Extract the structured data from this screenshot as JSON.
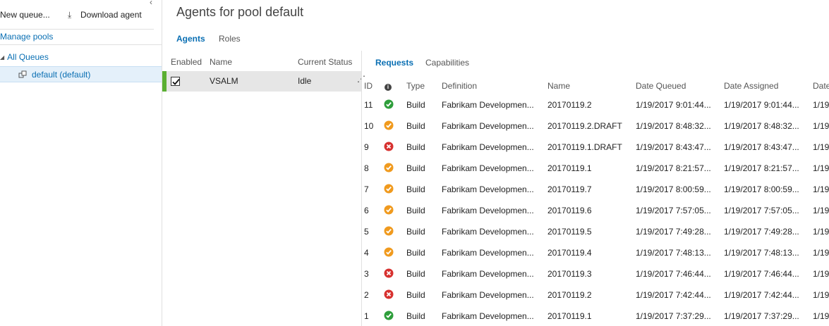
{
  "toolbar": {
    "new_queue": "New queue...",
    "download_agent": "Download agent",
    "manage_pools": "Manage pools",
    "collapse": "‹"
  },
  "tree": {
    "all_queues": "All Queues",
    "selected_queue": "default (default)"
  },
  "page": {
    "title": "Agents for pool default"
  },
  "tabs": {
    "agents": "Agents",
    "roles": "Roles"
  },
  "agents_table": {
    "headers": {
      "enabled": "Enabled",
      "name": "Name",
      "status": "Current Status"
    },
    "rows": [
      {
        "name": "VSALM",
        "status": "Idle",
        "enabled": true
      }
    ]
  },
  "detail_tabs": {
    "requests": "Requests",
    "capabilities": "Capabilities"
  },
  "requests": {
    "headers": {
      "id": "ID",
      "info": "i",
      "type": "Type",
      "definition": "Definition",
      "name": "Name",
      "date_queued": "Date Queued",
      "date_assigned": "Date Assigned",
      "date_extra": "Date"
    },
    "rows": [
      {
        "id": "11",
        "result": "success",
        "type": "Build",
        "definition": "Fabrikam Developmen...",
        "name": "20170119.2",
        "date_queued": "1/19/2017 9:01:44...",
        "date_assigned": "1/19/2017 9:01:44...",
        "date_extra": "1/19"
      },
      {
        "id": "10",
        "result": "partial",
        "type": "Build",
        "definition": "Fabrikam Developmen...",
        "name": "20170119.2.DRAFT",
        "date_queued": "1/19/2017 8:48:32...",
        "date_assigned": "1/19/2017 8:48:32...",
        "date_extra": "1/19"
      },
      {
        "id": "9",
        "result": "failed",
        "type": "Build",
        "definition": "Fabrikam Developmen...",
        "name": "20170119.1.DRAFT",
        "date_queued": "1/19/2017 8:43:47...",
        "date_assigned": "1/19/2017 8:43:47...",
        "date_extra": "1/19"
      },
      {
        "id": "8",
        "result": "partial",
        "type": "Build",
        "definition": "Fabrikam Developmen...",
        "name": "20170119.1",
        "date_queued": "1/19/2017 8:21:57...",
        "date_assigned": "1/19/2017 8:21:57...",
        "date_extra": "1/19"
      },
      {
        "id": "7",
        "result": "partial",
        "type": "Build",
        "definition": "Fabrikam Developmen...",
        "name": "20170119.7",
        "date_queued": "1/19/2017 8:00:59...",
        "date_assigned": "1/19/2017 8:00:59...",
        "date_extra": "1/19"
      },
      {
        "id": "6",
        "result": "partial",
        "type": "Build",
        "definition": "Fabrikam Developmen...",
        "name": "20170119.6",
        "date_queued": "1/19/2017 7:57:05...",
        "date_assigned": "1/19/2017 7:57:05...",
        "date_extra": "1/19"
      },
      {
        "id": "5",
        "result": "partial",
        "type": "Build",
        "definition": "Fabrikam Developmen...",
        "name": "20170119.5",
        "date_queued": "1/19/2017 7:49:28...",
        "date_assigned": "1/19/2017 7:49:28...",
        "date_extra": "1/19"
      },
      {
        "id": "4",
        "result": "partial",
        "type": "Build",
        "definition": "Fabrikam Developmen...",
        "name": "20170119.4",
        "date_queued": "1/19/2017 7:48:13...",
        "date_assigned": "1/19/2017 7:48:13...",
        "date_extra": "1/19"
      },
      {
        "id": "3",
        "result": "failed",
        "type": "Build",
        "definition": "Fabrikam Developmen...",
        "name": "20170119.3",
        "date_queued": "1/19/2017 7:46:44...",
        "date_assigned": "1/19/2017 7:46:44...",
        "date_extra": "1/19"
      },
      {
        "id": "2",
        "result": "failed",
        "type": "Build",
        "definition": "Fabrikam Developmen...",
        "name": "20170119.2",
        "date_queued": "1/19/2017 7:42:44...",
        "date_assigned": "1/19/2017 7:42:44...",
        "date_extra": "1/19"
      },
      {
        "id": "1",
        "result": "success",
        "type": "Build",
        "definition": "Fabrikam Developmen...",
        "name": "20170119.1",
        "date_queued": "1/19/2017 7:37:29...",
        "date_assigned": "1/19/2017 7:37:29...",
        "date_extra": "1/19"
      }
    ]
  },
  "colors": {
    "accent": "#0a6fb3",
    "success": "#2e9e3b",
    "partial": "#f09a1e",
    "failed": "#d7312f",
    "agent_bar": "#5aaf32"
  }
}
